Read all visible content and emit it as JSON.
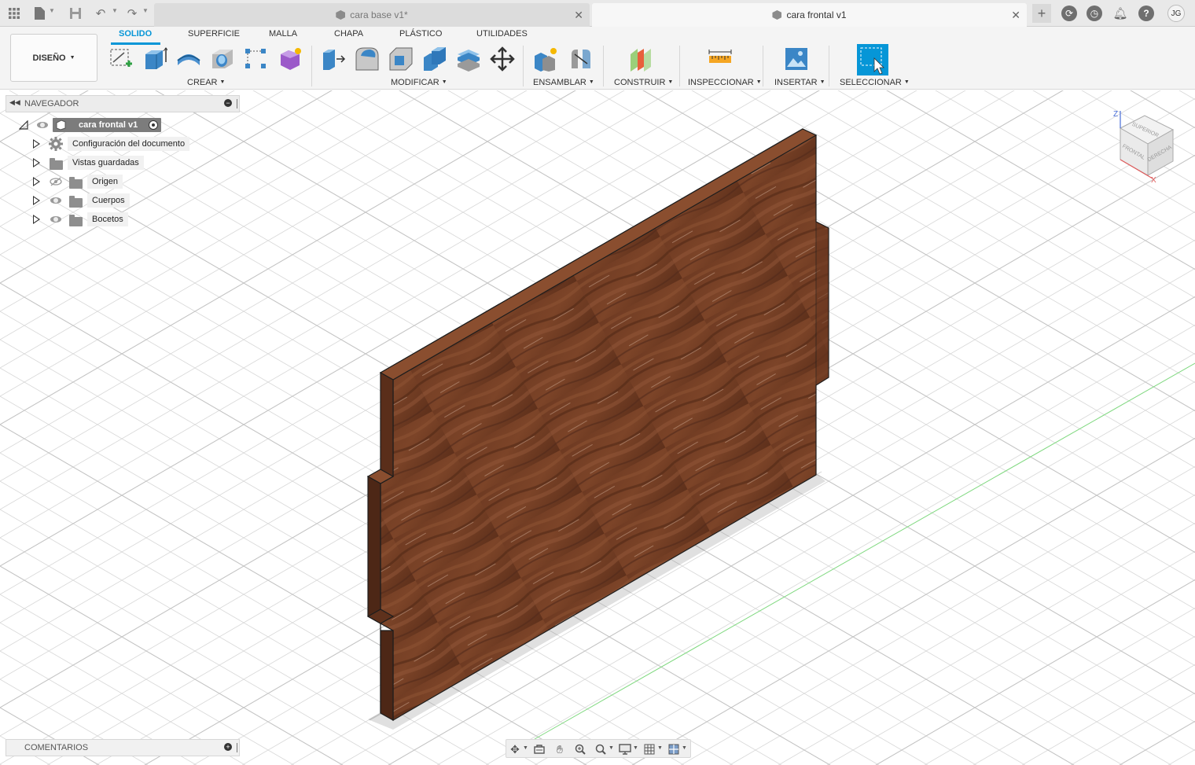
{
  "app": {
    "user_initials": "JG"
  },
  "tabs": [
    {
      "label": "cara base v1*",
      "active": false
    },
    {
      "label": "cara frontal v1",
      "active": true
    }
  ],
  "toolbar": {
    "workspace": "DISEÑO",
    "ws_tabs": [
      "SOLIDO",
      "SUPERFICIE",
      "MALLA",
      "CHAPA",
      "PLÁSTICO",
      "UTILIDADES"
    ],
    "active_tab": "SOLIDO",
    "groups": {
      "crear": "CREAR",
      "modificar": "MODIFICAR",
      "ensamblar": "ENSAMBLAR",
      "construir": "CONSTRUIR",
      "inspeccionar": "INSPECCIONAR",
      "insertar": "INSERTAR",
      "seleccionar": "SELECCIONAR"
    },
    "accent_color": "#0696d7"
  },
  "navigator": {
    "title": "NAVEGADOR",
    "root": "cara frontal v1",
    "items": [
      {
        "label": "Configuración del documento",
        "icon": "gear-icon"
      },
      {
        "label": "Vistas guardadas",
        "icon": "folder-icon"
      },
      {
        "label": "Origen",
        "icon": "folder-icon",
        "visible": false
      },
      {
        "label": "Cuerpos",
        "icon": "folder-icon",
        "visible": true
      },
      {
        "label": "Bocetos",
        "icon": "folder-icon",
        "visible": true
      }
    ]
  },
  "comments": {
    "title": "COMENTARIOS"
  },
  "viewcube": {
    "top": "SUPERIOR",
    "front": "FRONTAL",
    "right": "DERECHA",
    "axis_z": "Z",
    "axis_x": "X"
  }
}
